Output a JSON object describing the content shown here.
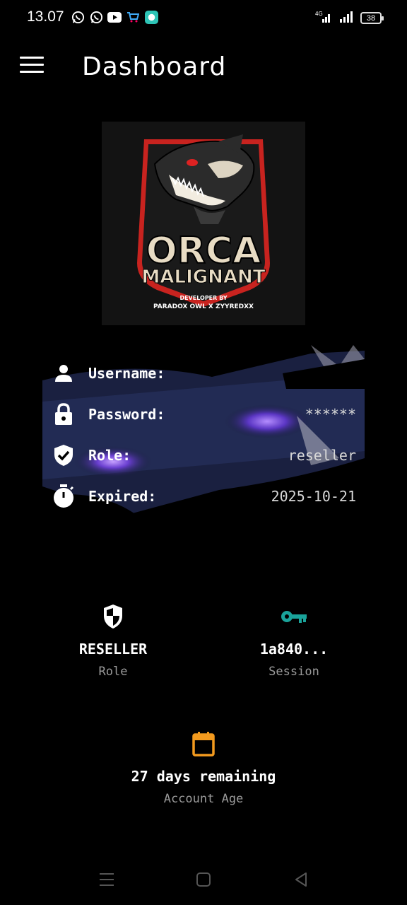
{
  "status_bar": {
    "time": "13.07",
    "network": "4G",
    "battery": "38"
  },
  "header": {
    "title": "Dashboard",
    "menu_icon": "hamburger-menu-icon"
  },
  "logo": {
    "line1": "ORCA",
    "line2": "MALIGNANT",
    "developer_label": "DEVELOPER BY",
    "developer_names": "PARADOX OWL X ZYYREDXX"
  },
  "account": {
    "rows": [
      {
        "icon": "person-icon",
        "label": "Username:",
        "value": ""
      },
      {
        "icon": "lock-icon",
        "label": "Password:",
        "value": "******"
      },
      {
        "icon": "shield-check-icon",
        "label": "Role:",
        "value": "reseller"
      },
      {
        "icon": "stopwatch-icon",
        "label": "Expired:",
        "value": "2025-10-21"
      }
    ]
  },
  "stats": {
    "role": {
      "icon": "shield-icon",
      "value": "RESELLER",
      "label": "Role"
    },
    "session": {
      "icon": "key-icon",
      "value": "1a840...",
      "label": "Session"
    },
    "account_age": {
      "icon": "calendar-icon",
      "value": "27 days remaining",
      "label": "Account Age"
    }
  },
  "colors": {
    "background": "#000000",
    "key_accent": "#1aa39a",
    "calendar_accent": "#f39a1e",
    "logo_red": "#c8231f"
  }
}
